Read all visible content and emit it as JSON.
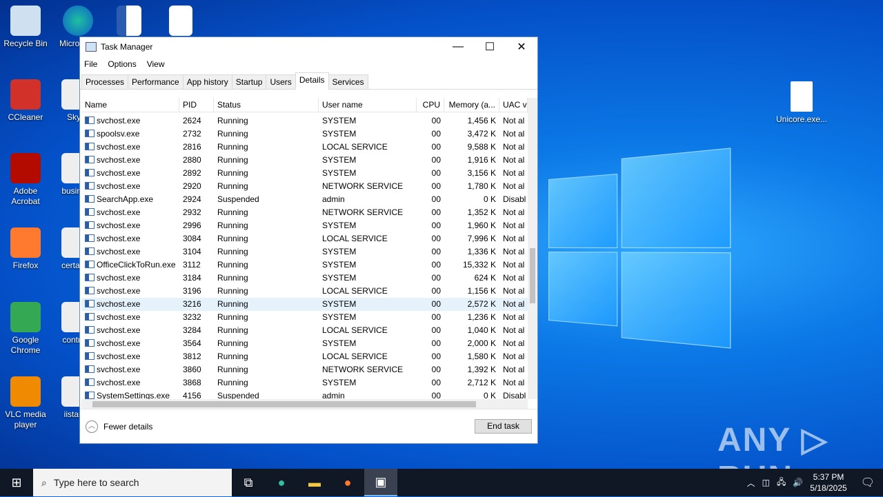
{
  "desktop": {
    "icons": [
      "Recycle Bin",
      "CCleaner",
      "Adobe Acrobat",
      "Firefox",
      "Google Chrome",
      "VLC media player"
    ],
    "partial_icons": [
      "Micro Edg",
      "Sky",
      "busine",
      "certain",
      "contro",
      "iistart"
    ],
    "right_icon": "Unicore.exe..."
  },
  "window": {
    "title": "Task Manager",
    "minimize": "—",
    "maximize": "☐",
    "close": "✕",
    "menu": [
      "File",
      "Options",
      "View"
    ],
    "tabs": [
      "Processes",
      "Performance",
      "App history",
      "Startup",
      "Users",
      "Details",
      "Services"
    ],
    "active_tab": "Details",
    "columns": [
      "Name",
      "PID",
      "Status",
      "User name",
      "CPU",
      "Memory (a...",
      "UAC v"
    ],
    "rows": [
      [
        "svchost.exe",
        "2624",
        "Running",
        "SYSTEM",
        "00",
        "1,456 K",
        "Not al"
      ],
      [
        "spoolsv.exe",
        "2732",
        "Running",
        "SYSTEM",
        "00",
        "3,472 K",
        "Not al"
      ],
      [
        "svchost.exe",
        "2816",
        "Running",
        "LOCAL SERVICE",
        "00",
        "9,588 K",
        "Not al"
      ],
      [
        "svchost.exe",
        "2880",
        "Running",
        "SYSTEM",
        "00",
        "1,916 K",
        "Not al"
      ],
      [
        "svchost.exe",
        "2892",
        "Running",
        "SYSTEM",
        "00",
        "3,156 K",
        "Not al"
      ],
      [
        "svchost.exe",
        "2920",
        "Running",
        "NETWORK SERVICE",
        "00",
        "1,780 K",
        "Not al"
      ],
      [
        "SearchApp.exe",
        "2924",
        "Suspended",
        "admin",
        "00",
        "0 K",
        "Disabl"
      ],
      [
        "svchost.exe",
        "2932",
        "Running",
        "NETWORK SERVICE",
        "00",
        "1,352 K",
        "Not al"
      ],
      [
        "svchost.exe",
        "2996",
        "Running",
        "SYSTEM",
        "00",
        "1,960 K",
        "Not al"
      ],
      [
        "svchost.exe",
        "3084",
        "Running",
        "LOCAL SERVICE",
        "00",
        "7,996 K",
        "Not al"
      ],
      [
        "svchost.exe",
        "3104",
        "Running",
        "SYSTEM",
        "00",
        "1,336 K",
        "Not al"
      ],
      [
        "OfficeClickToRun.exe",
        "3112",
        "Running",
        "SYSTEM",
        "00",
        "15,332 K",
        "Not al"
      ],
      [
        "svchost.exe",
        "3184",
        "Running",
        "SYSTEM",
        "00",
        "624 K",
        "Not al"
      ],
      [
        "svchost.exe",
        "3196",
        "Running",
        "LOCAL SERVICE",
        "00",
        "1,156 K",
        "Not al"
      ],
      [
        "svchost.exe",
        "3216",
        "Running",
        "SYSTEM",
        "00",
        "2,572 K",
        "Not al"
      ],
      [
        "svchost.exe",
        "3232",
        "Running",
        "SYSTEM",
        "00",
        "1,236 K",
        "Not al"
      ],
      [
        "svchost.exe",
        "3284",
        "Running",
        "LOCAL SERVICE",
        "00",
        "1,040 K",
        "Not al"
      ],
      [
        "svchost.exe",
        "3564",
        "Running",
        "SYSTEM",
        "00",
        "2,000 K",
        "Not al"
      ],
      [
        "svchost.exe",
        "3812",
        "Running",
        "LOCAL SERVICE",
        "00",
        "1,580 K",
        "Not al"
      ],
      [
        "svchost.exe",
        "3860",
        "Running",
        "NETWORK SERVICE",
        "00",
        "1,392 K",
        "Not al"
      ],
      [
        "svchost.exe",
        "3868",
        "Running",
        "SYSTEM",
        "00",
        "2,712 K",
        "Not al"
      ],
      [
        "SystemSettings.exe",
        "4156",
        "Suspended",
        "admin",
        "00",
        "0 K",
        "Disabl"
      ]
    ],
    "selected_row": 14,
    "fewer_details": "Fewer details",
    "end_task": "End task"
  },
  "taskbar": {
    "search_placeholder": "Type here to search",
    "time": "5:37 PM",
    "date": "5/18/2025"
  },
  "watermark": "ANY ▷ RUN"
}
